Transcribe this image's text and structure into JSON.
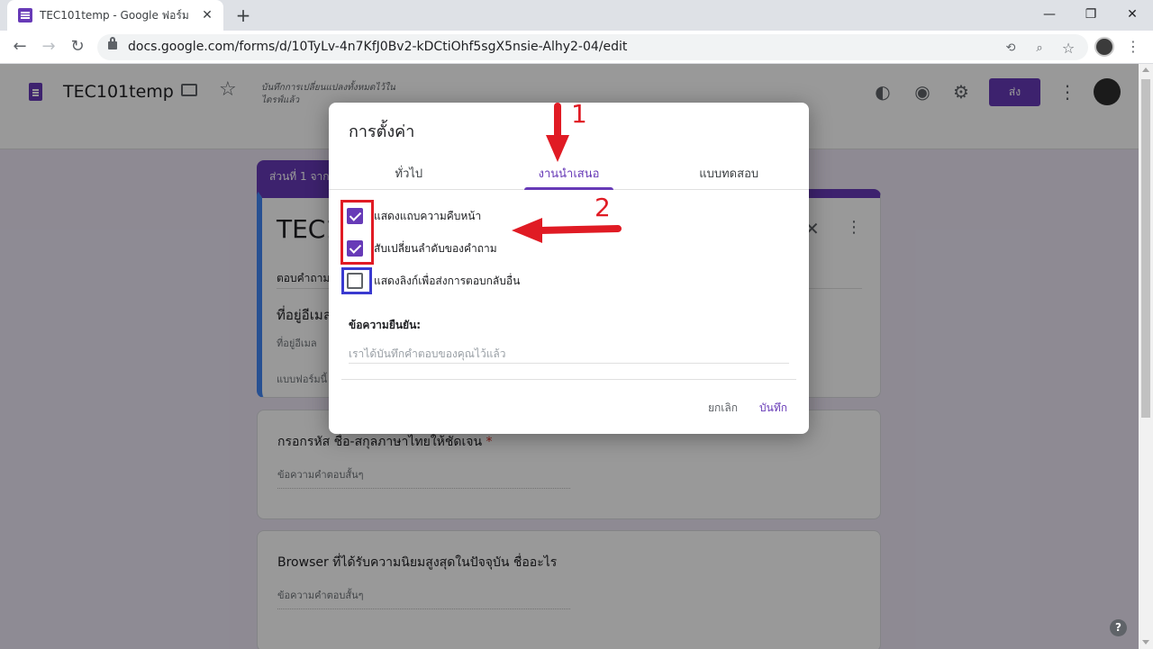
{
  "browser": {
    "tab_title": "TEC101temp - Google ฟอร์ม",
    "tab_close": "✕",
    "new_tab": "+",
    "window_controls": {
      "minimize": "—",
      "restore": "❐",
      "close": "✕"
    },
    "nav": {
      "back": "←",
      "forward": "→",
      "reload": "↻"
    },
    "url": "docs.google.com/forms/d/10TyLv-4n7KfJ0Bv2-kDCtiOhf5sgX5nsie-Alhy2-04/edit",
    "omnibox_icons": [
      "translate-icon",
      "zoom-icon",
      "bookmark-star-icon"
    ],
    "menu": "⋮"
  },
  "form_header": {
    "title": "TEC101temp",
    "saved_note": "บันทึกการเปลี่ยนแปลงทั้งหมดไว้ในไดรฟ์แล้ว",
    "send_label": "ส่ง",
    "star": "☆",
    "icons": {
      "palette": "🎨",
      "preview": "👁",
      "settings": "⚙",
      "more": "⋮"
    }
  },
  "form_body": {
    "section_tag": "ส่วนที่ 1 จาก",
    "header_title": "TEC1",
    "header_desc": "ตอบคำถาม",
    "email_label": "ที่อยู่อีเมล",
    "email_field": "ที่อยู่อีเมล",
    "form_note": "แบบฟอร์มนี้",
    "close_x": "✕",
    "more_v": "⋮",
    "questions": [
      {
        "title": "กรอกรหัส ชื่อ-สกุลภาษาไทยให้ชัดเจน",
        "required_mark": "*",
        "answer_hint": "ข้อความคำตอบสั้นๆ"
      },
      {
        "title": "Browser ที่ได้รับความนิยมสูงสุดในปัจจุบัน ชื่ออะไร",
        "answer_hint": "ข้อความคำตอบสั้นๆ"
      }
    ],
    "help": "?"
  },
  "dialog": {
    "title": "การตั้งค่า",
    "tabs": [
      {
        "label": "ทั่วไป",
        "active": false
      },
      {
        "label": "งานนำเสนอ",
        "active": true
      },
      {
        "label": "แบบทดสอบ",
        "active": false
      }
    ],
    "options": [
      {
        "label": "แสดงแถบความคืบหน้า",
        "checked": true
      },
      {
        "label": "สับเปลี่ยนลำดับของคำถาม",
        "checked": true
      },
      {
        "label": "แสดงลิงก์เพื่อส่งการตอบกลับอื่น",
        "checked": false
      }
    ],
    "confirm_label": "ข้อความยืนยัน:",
    "confirm_placeholder": "เราได้บันทึกคำตอบของคุณไว้แล้ว",
    "cancel": "ยกเลิก",
    "save": "บันทึก"
  },
  "annotations": {
    "step1": "1",
    "step2": "2",
    "color_red": "#e01b24",
    "color_blue": "#3a3ad0"
  },
  "colors": {
    "brand_purple": "#673ab7",
    "accent_blue": "#4285f4"
  }
}
